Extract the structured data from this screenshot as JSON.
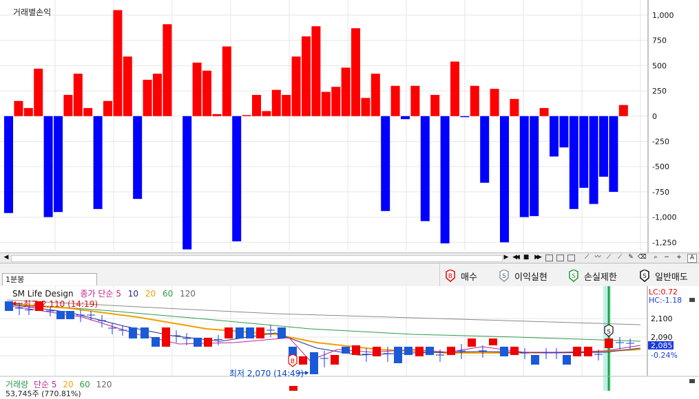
{
  "top_chart": {
    "title": "거래별손익",
    "axis_ticks": [
      "1,000",
      "750",
      "500",
      "250",
      "0",
      "-250",
      "-500",
      "-750",
      "-1,000",
      "-1,250"
    ],
    "chart_data": {
      "type": "bar",
      "ylim": [
        -1330,
        1150
      ],
      "values": [
        -960,
        150,
        80,
        470,
        -1000,
        -950,
        210,
        420,
        80,
        -920,
        150,
        1050,
        590,
        -820,
        360,
        420,
        910,
        0,
        -1320,
        530,
        450,
        20,
        690,
        -1240,
        10,
        210,
        50,
        260,
        210,
        590,
        790,
        890,
        240,
        290,
        480,
        870,
        180,
        420,
        -940,
        300,
        -30,
        300,
        -1040,
        210,
        -1260,
        540,
        -10,
        300,
        -660,
        270,
        -1250,
        170,
        -1000,
        -990,
        80,
        -400,
        -310,
        -920,
        -710,
        -870,
        -600,
        -750,
        110
      ],
      "colors": {
        "positive": "#ff0000",
        "negative": "#0000ff"
      }
    }
  },
  "toolbar": {
    "left_arrow": "◀",
    "right_arrow": "▶",
    "prev": "◀◀",
    "stop": "■",
    "next": "▶▶",
    "search": "🔍",
    "minus": "−",
    "plus": "+",
    "font": "A"
  },
  "tabs": {
    "interval": "1분봉"
  },
  "legend": {
    "buy": {
      "letter": "B",
      "label": "매수"
    },
    "profit": {
      "letter": "S",
      "label": "이익실현"
    },
    "stoploss": {
      "letter": "S",
      "label": "손실제한"
    },
    "sell": {
      "letter": "S",
      "label": "일반매도"
    }
  },
  "price_chart": {
    "instrument": "SM Life Design",
    "indicator": "종가 단순",
    "ma_periods": [
      "5",
      "10",
      "20",
      "60",
      "120"
    ],
    "lc": "LC:0.72",
    "hc": "HC:-1.18",
    "high_label": "최고 2,110 (14:19)",
    "low_label": "최저 2,070 (14:49)",
    "axis_ticks": [
      "2,100",
      "2,090",
      "2,085",
      "-0.24%"
    ],
    "marker_buy": "B",
    "marker_sell": "S"
  },
  "volume_chart": {
    "title": "거래량",
    "indicator": "단순",
    "ma_periods": [
      "5",
      "20",
      "60",
      "120"
    ],
    "value_partial": "53,745주 (770.81%)"
  }
}
